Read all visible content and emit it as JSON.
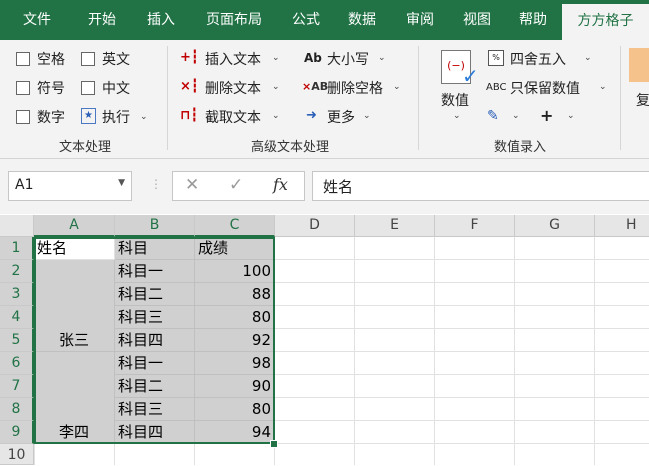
{
  "tabs": [
    "文件",
    "开始",
    "插入",
    "页面布局",
    "公式",
    "数据",
    "审阅",
    "视图",
    "帮助",
    "方方格子"
  ],
  "active_tab": "方方格子",
  "ribbon": {
    "text_group": {
      "items": [
        "空格",
        "英文",
        "符号",
        "中文",
        "数字",
        "执行"
      ],
      "label": "文本处理"
    },
    "advanced_group": {
      "insert_text": "插入文本",
      "delete_text": "删除文本",
      "extract_text": "截取文本",
      "case": "大小写",
      "delete_space": "删除空格",
      "more": "更多",
      "label": "高级文本处理"
    },
    "value_group": {
      "value_button": "数值",
      "round": "四舍五入",
      "keep_value": "只保留数值",
      "plus": "+",
      "label": "数值录入"
    },
    "partial_button": "复"
  },
  "namebox": "A1",
  "formula": "姓名",
  "fx_label": "fx",
  "columns": [
    "A",
    "B",
    "C",
    "D",
    "E",
    "F",
    "G",
    "H"
  ],
  "rows": [
    "1",
    "2",
    "3",
    "4",
    "5",
    "6",
    "7",
    "8",
    "9",
    "10"
  ],
  "table": {
    "headers": [
      "姓名",
      "科目",
      "成绩"
    ],
    "names": [
      "张三",
      "李四"
    ],
    "subjects": [
      "科目一",
      "科目二",
      "科目三",
      "科目四",
      "科目一",
      "科目二",
      "科目三",
      "科目四"
    ],
    "scores": [
      "100",
      "88",
      "80",
      "92",
      "98",
      "90",
      "80",
      "94"
    ]
  },
  "colors": {
    "accent": "#217346",
    "selection_fill": "#d0d0d0"
  }
}
